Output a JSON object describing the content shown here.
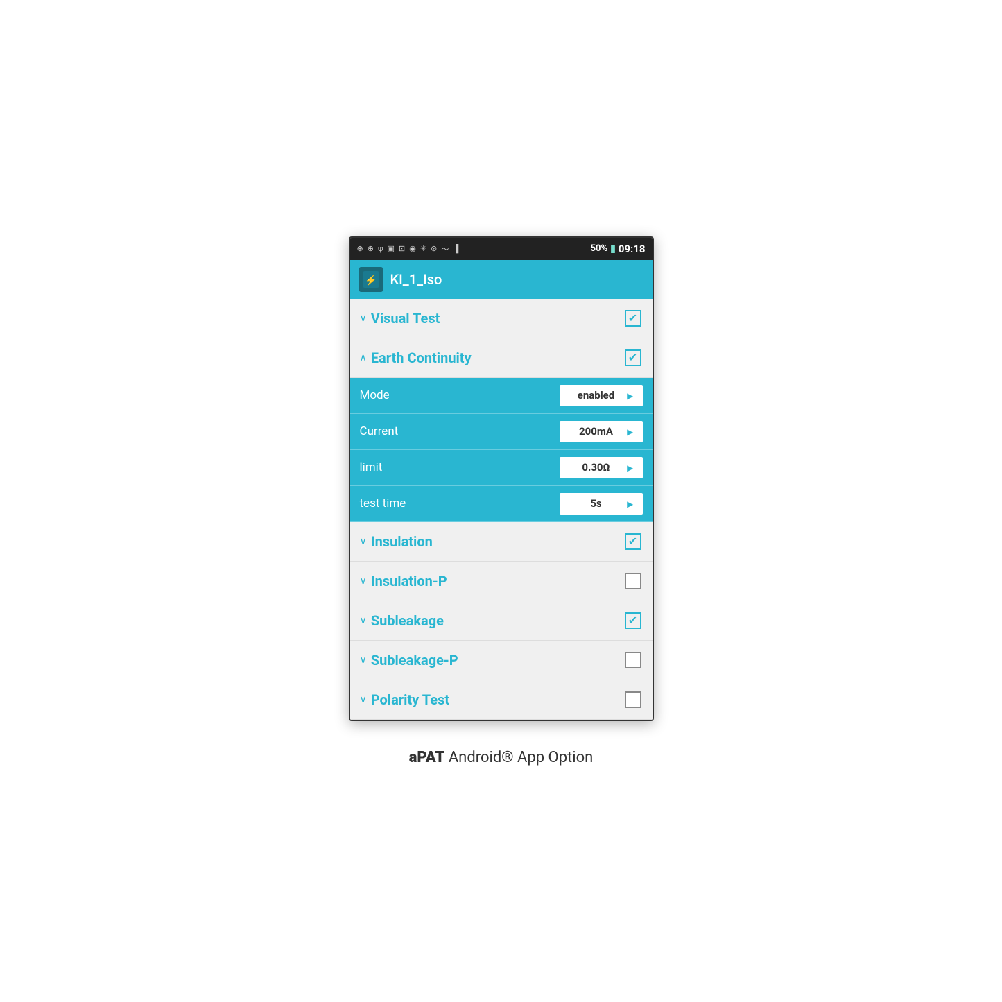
{
  "status_bar": {
    "left_icons": [
      "⊕",
      "⊕",
      "ψ",
      "▣",
      "⊡",
      "☁",
      "✳",
      "⊘"
    ],
    "battery": "50%",
    "time": "09:18"
  },
  "app_header": {
    "title": "KI_1_Iso",
    "icon_label": "🔧"
  },
  "sections": [
    {
      "id": "visual-test",
      "label": "Visual Test",
      "chevron": "∨",
      "checked": true,
      "expanded": false,
      "fields": []
    },
    {
      "id": "earth-continuity",
      "label": "Earth Continuity",
      "chevron": "∧",
      "checked": true,
      "expanded": true,
      "fields": [
        {
          "label": "Mode",
          "value": "enabled"
        },
        {
          "label": "Current",
          "value": "200mA"
        },
        {
          "label": "limit",
          "value": "0.30Ω"
        },
        {
          "label": "test time",
          "value": "5s"
        }
      ]
    },
    {
      "id": "insulation",
      "label": "Insulation",
      "chevron": "∨",
      "checked": true,
      "expanded": false,
      "fields": []
    },
    {
      "id": "insulation-p",
      "label": "Insulation-P",
      "chevron": "∨",
      "checked": false,
      "expanded": false,
      "fields": []
    },
    {
      "id": "subleakage",
      "label": "Subleakage",
      "chevron": "∨",
      "checked": true,
      "expanded": false,
      "fields": []
    },
    {
      "id": "subleakage-p",
      "label": "Subleakage-P",
      "chevron": "∨",
      "checked": false,
      "expanded": false,
      "fields": []
    },
    {
      "id": "polarity-test",
      "label": "Polarity Test",
      "chevron": "∨",
      "checked": false,
      "expanded": false,
      "fields": [],
      "partial": true
    }
  ],
  "caption": {
    "bold_part": "aPAT",
    "regular_part": " Android® App Option"
  }
}
